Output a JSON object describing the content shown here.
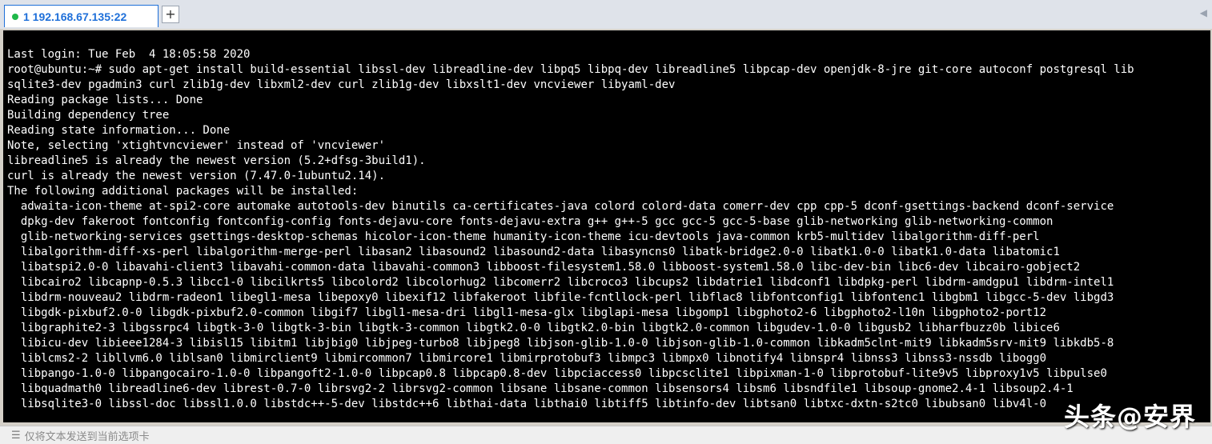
{
  "tab": {
    "label": "1 192.168.67.135:22",
    "status_color": "#1fb84a",
    "add_label": "+",
    "scroll_label": "◀"
  },
  "terminal": {
    "lines": [
      "Last login: Tue Feb  4 18:05:58 2020",
      "root@ubuntu:~# sudo apt-get install build-essential libssl-dev libreadline-dev libpq5 libpq-dev libreadline5 libpcap-dev openjdk-8-jre git-core autoconf postgresql lib",
      "sqlite3-dev pgadmin3 curl zlib1g-dev libxml2-dev curl zlib1g-dev libxslt1-dev vncviewer libyaml-dev",
      "Reading package lists... Done",
      "Building dependency tree",
      "Reading state information... Done",
      "Note, selecting 'xtightvncviewer' instead of 'vncviewer'",
      "libreadline5 is already the newest version (5.2+dfsg-3build1).",
      "curl is already the newest version (7.47.0-1ubuntu2.14).",
      "The following additional packages will be installed:",
      "  adwaita-icon-theme at-spi2-core automake autotools-dev binutils ca-certificates-java colord colord-data comerr-dev cpp cpp-5 dconf-gsettings-backend dconf-service",
      "  dpkg-dev fakeroot fontconfig fontconfig-config fonts-dejavu-core fonts-dejavu-extra g++ g++-5 gcc gcc-5 gcc-5-base glib-networking glib-networking-common",
      "  glib-networking-services gsettings-desktop-schemas hicolor-icon-theme humanity-icon-theme icu-devtools java-common krb5-multidev libalgorithm-diff-perl",
      "  libalgorithm-diff-xs-perl libalgorithm-merge-perl libasan2 libasound2 libasound2-data libasyncns0 libatk-bridge2.0-0 libatk1.0-0 libatk1.0-data libatomic1",
      "  libatspi2.0-0 libavahi-client3 libavahi-common-data libavahi-common3 libboost-filesystem1.58.0 libboost-system1.58.0 libc-dev-bin libc6-dev libcairo-gobject2",
      "  libcairo2 libcapnp-0.5.3 libcc1-0 libcilkrts5 libcolord2 libcolorhug2 libcomerr2 libcroco3 libcups2 libdatrie1 libdconf1 libdpkg-perl libdrm-amdgpu1 libdrm-intel1",
      "  libdrm-nouveau2 libdrm-radeon1 libegl1-mesa libepoxy0 libexif12 libfakeroot libfile-fcntllock-perl libflac8 libfontconfig1 libfontenc1 libgbm1 libgcc-5-dev libgd3",
      "  libgdk-pixbuf2.0-0 libgdk-pixbuf2.0-common libgif7 libgl1-mesa-dri libgl1-mesa-glx libglapi-mesa libgomp1 libgphoto2-6 libgphoto2-l10n libgphoto2-port12",
      "  libgraphite2-3 libgssrpc4 libgtk-3-0 libgtk-3-bin libgtk-3-common libgtk2.0-0 libgtk2.0-bin libgtk2.0-common libgudev-1.0-0 libgusb2 libharfbuzz0b libice6",
      "  libicu-dev libieee1284-3 libisl15 libitm1 libjbig0 libjpeg-turbo8 libjpeg8 libjson-glib-1.0-0 libjson-glib-1.0-common libkadm5clnt-mit9 libkadm5srv-mit9 libkdb5-8",
      "  liblcms2-2 libllvm6.0 liblsan0 libmirclient9 libmircommon7 libmircore1 libmirprotobuf3 libmpc3 libmpx0 libnotify4 libnspr4 libnss3 libnss3-nssdb libogg0",
      "  libpango-1.0-0 libpangocairo-1.0-0 libpangoft2-1.0-0 libpcap0.8 libpcap0.8-dev libpciaccess0 libpcsclite1 libpixman-1-0 libprotobuf-lite9v5 libproxy1v5 libpulse0",
      "  libquadmath0 libreadline6-dev librest-0.7-0 librsvg2-2 librsvg2-common libsane libsane-common libsensors4 libsm6 libsndfile1 libsoup-gnome2.4-1 libsoup2.4-1",
      "  libsqlite3-0 libssl-doc libssl1.0.0 libstdc++-5-dev libstdc++6 libthai-data libthai0 libtiff5 libtinfo-dev libtsan0 libtxc-dxtn-s2tc0 libubsan0 libv4l-0"
    ]
  },
  "statusbar": {
    "placeholder": "仅将文本发送到当前选项卡",
    "icon": "☰"
  },
  "watermark": {
    "text": "头条@安界"
  }
}
